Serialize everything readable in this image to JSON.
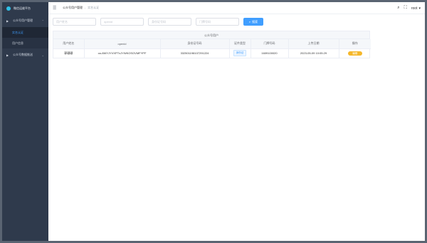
{
  "sidebar": {
    "brand": "微信运维平台",
    "groups": [
      {
        "label": "公众号用户管理",
        "items": [
          "实名认证",
          "用户信息"
        ]
      },
      {
        "label": "公众号数据推送",
        "items": []
      }
    ]
  },
  "header": {
    "breadcrumb": [
      "公众号用户管理",
      "实名认证"
    ],
    "user": "root"
  },
  "filters": {
    "name_placeholder": "用户姓名",
    "openid_placeholder": "openid",
    "idcard_placeholder": "身份证号码",
    "door_placeholder": "门牌号码",
    "search_label": "搜索"
  },
  "table": {
    "caption": "公众号用户",
    "columns": [
      "用户姓名",
      "openid",
      "身份证号码",
      "证件类型",
      "门牌号码",
      "上传日期",
      "操作"
    ],
    "rows": [
      {
        "name": "郭珊珊",
        "openid": "oo-8WYJYVXPTvJYWKOSOVMFYPF",
        "idcard": "332501198107291224",
        "type": "身份证",
        "door": "1609100020",
        "date": "2023-05-09 10:05:29",
        "op": "编辑"
      }
    ]
  },
  "colors": {
    "accent": "#409eff",
    "sidebar": "#2f3a4c",
    "op_button": "#f5b72a"
  }
}
